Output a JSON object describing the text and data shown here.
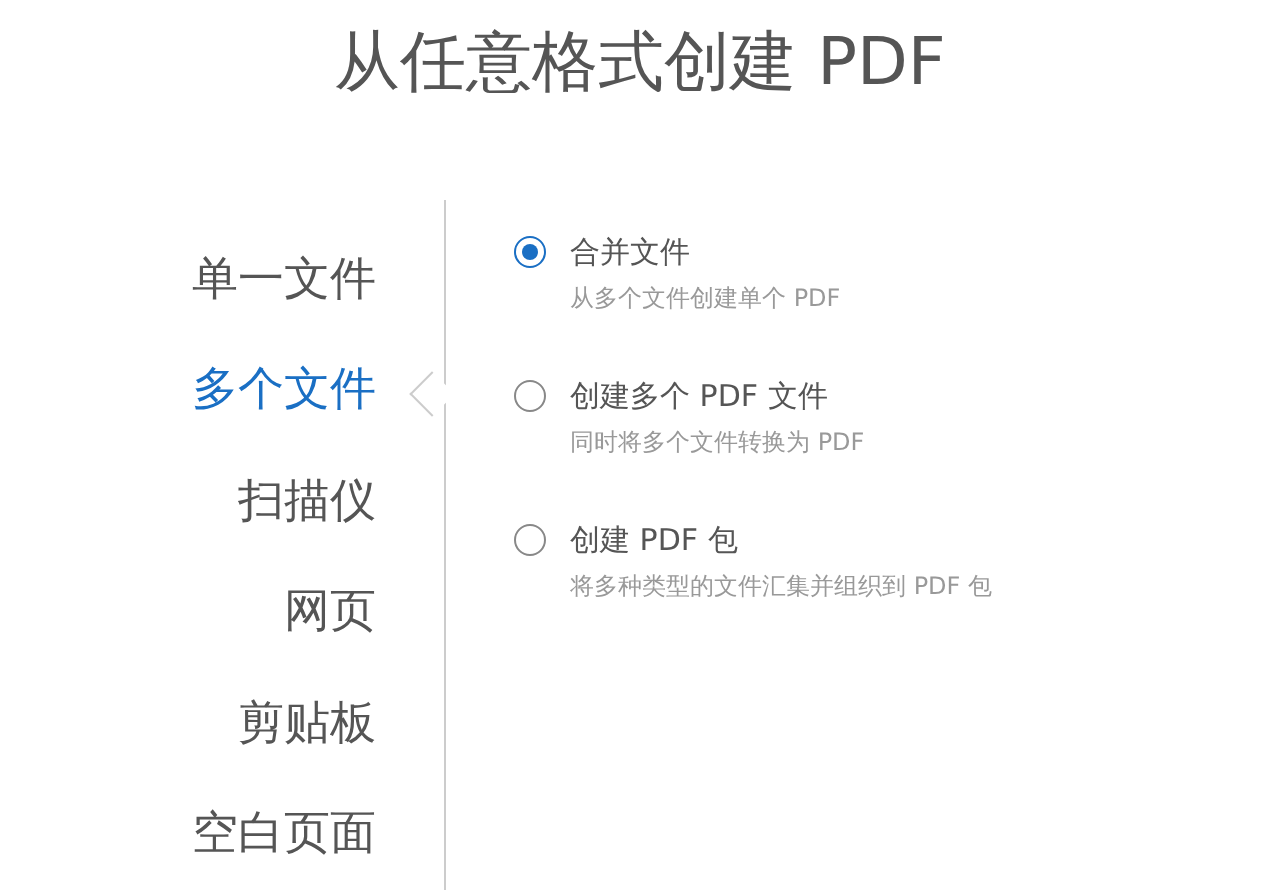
{
  "title": "从任意格式创建 PDF",
  "sidebar": {
    "items": [
      {
        "label": "单一文件",
        "selected": false
      },
      {
        "label": "多个文件",
        "selected": true
      },
      {
        "label": "扫描仪",
        "selected": false
      },
      {
        "label": "网页",
        "selected": false
      },
      {
        "label": "剪贴板",
        "selected": false
      },
      {
        "label": "空白页面",
        "selected": false
      }
    ]
  },
  "options": [
    {
      "label": "合并文件",
      "description": "从多个文件创建单个 PDF",
      "selected": true
    },
    {
      "label": "创建多个 PDF 文件",
      "description": "同时将多个文件转换为 PDF",
      "selected": false
    },
    {
      "label": "创建 PDF 包",
      "description": "将多种类型的文件汇集并组织到 PDF 包",
      "selected": false
    }
  ]
}
